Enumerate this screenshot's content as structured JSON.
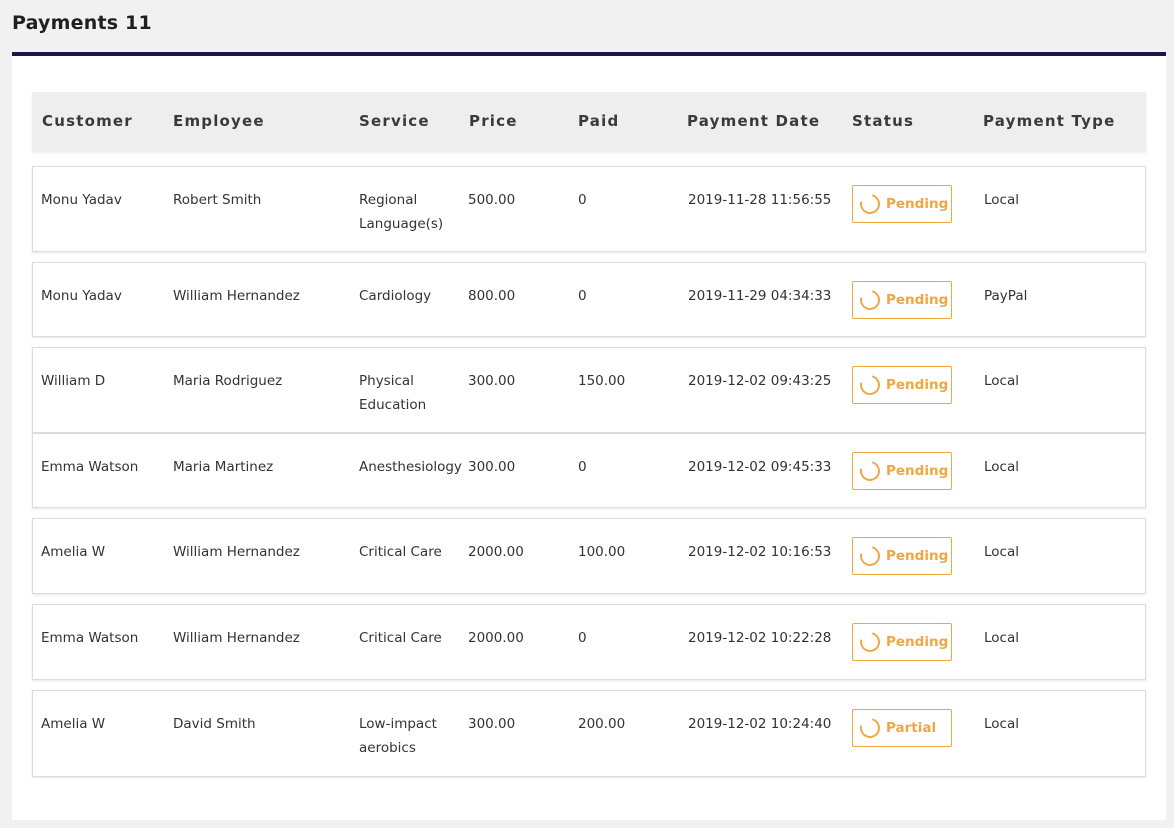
{
  "page": {
    "title": "Payments 11"
  },
  "table": {
    "headers": [
      "Customer",
      "Employee",
      "Service",
      "Price",
      "Paid",
      "Payment Date",
      "Status",
      "Payment Type"
    ],
    "rows": [
      {
        "customer": "Monu Yadav",
        "employee": "Robert Smith",
        "service": "Regional Language(s)",
        "price": "500.00",
        "paid": "0",
        "date": "2019-11-28 11:56:55",
        "status": "Pending",
        "type": "Local"
      },
      {
        "customer": "Monu Yadav",
        "employee": "William Hernandez",
        "service": "Cardiology",
        "price": "800.00",
        "paid": "0",
        "date": "2019-11-29 04:34:33",
        "status": "Pending",
        "type": "PayPal"
      },
      {
        "customer": "William D",
        "employee": "Maria Rodriguez",
        "service": "Physical Education",
        "price": "300.00",
        "paid": "150.00",
        "date": "2019-12-02 09:43:25",
        "status": "Pending",
        "type": "Local"
      },
      {
        "customer": "Emma Watson",
        "employee": "Maria Martinez",
        "service": "Anesthesiology",
        "price": "300.00",
        "paid": "0",
        "date": "2019-12-02 09:45:33",
        "status": "Pending",
        "type": "Local"
      },
      {
        "customer": "Amelia W",
        "employee": "William Hernandez",
        "service": "Critical Care",
        "price": "2000.00",
        "paid": "100.00",
        "date": "2019-12-02 10:16:53",
        "status": "Pending",
        "type": "Local"
      },
      {
        "customer": "Emma Watson",
        "employee": "William Hernandez",
        "service": "Critical Care",
        "price": "2000.00",
        "paid": "0",
        "date": "2019-12-02 10:22:28",
        "status": "Pending",
        "type": "Local"
      },
      {
        "customer": "Amelia W",
        "employee": "David Smith",
        "service": "Low-impact aerobics",
        "price": "300.00",
        "paid": "200.00",
        "date": "2019-12-02 10:24:40",
        "status": "Partial",
        "type": "Local"
      }
    ]
  },
  "colors": {
    "accent_border": "#20124d",
    "status_color": "#f0a742"
  },
  "icons": {
    "status": "spinner-icon"
  }
}
